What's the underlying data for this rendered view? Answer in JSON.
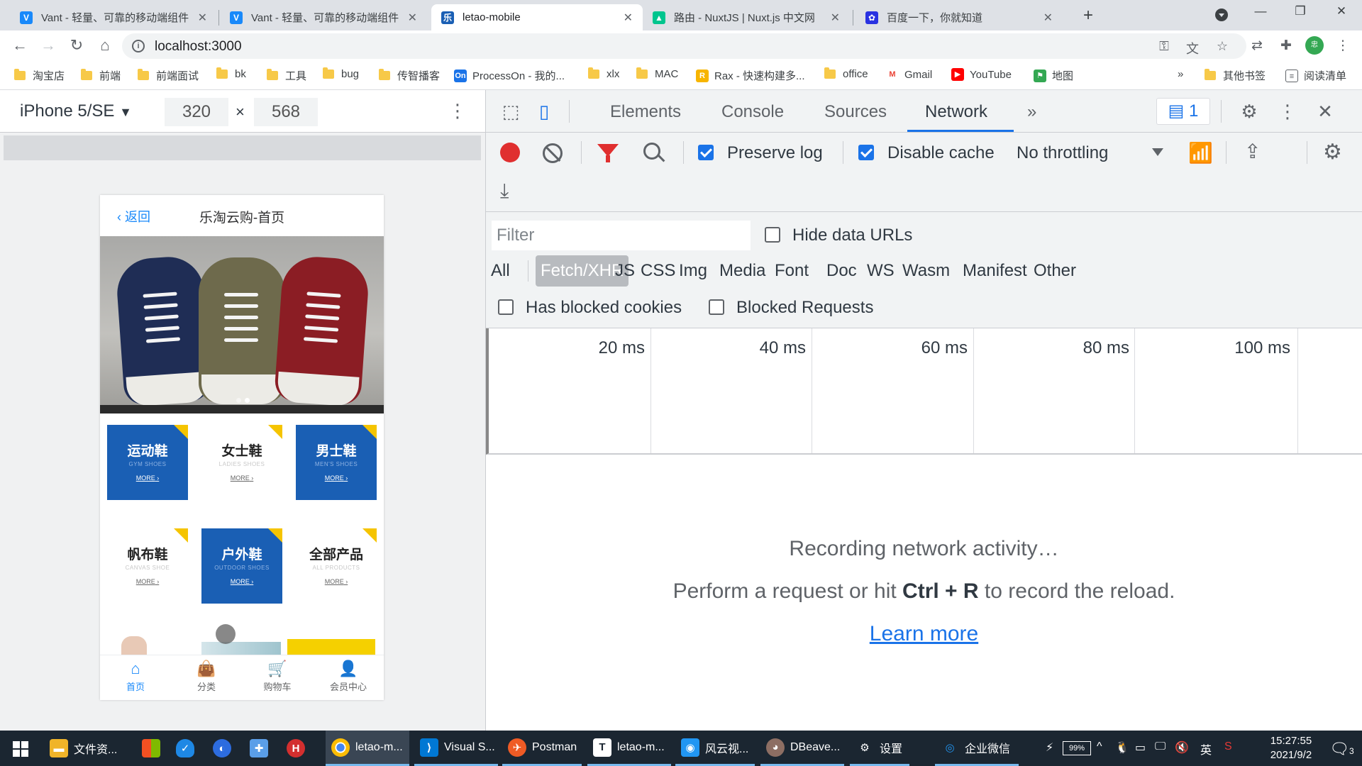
{
  "browser": {
    "tabs": [
      {
        "title": "Vant - 轻量、可靠的移动端组件",
        "icon": "vant-icon",
        "color": "#1989fa"
      },
      {
        "title": "Vant - 轻量、可靠的移动端组件",
        "icon": "vant-icon",
        "color": "#1989fa"
      },
      {
        "title": "letao-mobile",
        "icon": "letao-icon",
        "color": "#1a5fb4"
      },
      {
        "title": "路由 - NuxtJS | Nuxt.js 中文网",
        "icon": "nuxt-icon",
        "color": "#00c58e"
      },
      {
        "title": "百度一下，你就知道",
        "icon": "baidu-icon",
        "color": "#2932e1"
      }
    ],
    "active_tab": 2,
    "new_tab": "+",
    "url": "localhost:3000",
    "bookmarks": [
      {
        "label": "淘宝店",
        "type": "folder"
      },
      {
        "label": "前端",
        "type": "folder"
      },
      {
        "label": "前端面试",
        "type": "folder"
      },
      {
        "label": "bk",
        "type": "folder"
      },
      {
        "label": "工具",
        "type": "folder"
      },
      {
        "label": "bug",
        "type": "folder"
      },
      {
        "label": "传智播客",
        "type": "folder"
      },
      {
        "label": "ProcessOn - 我的...",
        "type": "site",
        "icon": "processon-icon"
      },
      {
        "label": "xlx",
        "type": "folder"
      },
      {
        "label": "MAC",
        "type": "folder"
      },
      {
        "label": "Rax - 快速构建多...",
        "type": "site",
        "icon": "rax-icon"
      },
      {
        "label": "office",
        "type": "folder"
      },
      {
        "label": "Gmail",
        "type": "site",
        "icon": "gmail-icon"
      },
      {
        "label": "YouTube",
        "type": "site",
        "icon": "youtube-icon"
      },
      {
        "label": "地图",
        "type": "site",
        "icon": "maps-icon"
      },
      {
        "label": "»",
        "type": "overflow"
      },
      {
        "label": "其他书签",
        "type": "folder"
      },
      {
        "label": "阅读清单",
        "type": "reading-list"
      }
    ]
  },
  "device_toolbar": {
    "device": "iPhone 5/SE",
    "width": "320",
    "height": "568",
    "times": "×"
  },
  "phone": {
    "back_label": "返回",
    "title": "乐淘云购-首页",
    "categories": [
      {
        "name": "运动鞋",
        "en": "GYM SHOES",
        "more": "MORE",
        "style": "blue"
      },
      {
        "name": "女士鞋",
        "en": "LADIES SHOES",
        "more": "MORE",
        "style": "white"
      },
      {
        "name": "男士鞋",
        "en": "MEN'S SHOES",
        "more": "MORE",
        "style": "blue"
      },
      {
        "name": "帆布鞋",
        "en": "CANVAS SHOE",
        "more": "MORE",
        "style": "white"
      },
      {
        "name": "户外鞋",
        "en": "OUTDOOR SHOES",
        "more": "MORE",
        "style": "blue"
      },
      {
        "name": "全部产品",
        "en": "ALL PRODUCTS",
        "more": "MORE",
        "style": "white"
      }
    ],
    "tabbar": [
      {
        "label": "首页",
        "icon": "home-icon"
      },
      {
        "label": "分类",
        "icon": "category-bag-icon"
      },
      {
        "label": "购物车",
        "icon": "cart-icon"
      },
      {
        "label": "会员中心",
        "icon": "user-icon"
      }
    ]
  },
  "devtools": {
    "tabs": [
      "Elements",
      "Console",
      "Sources",
      "Network"
    ],
    "active_tab": "Network",
    "more_tabs": "»",
    "issues_count": "1",
    "preserve_log": {
      "label": "Preserve log",
      "checked": true
    },
    "disable_cache": {
      "label": "Disable cache",
      "checked": true
    },
    "throttling": "No throttling",
    "filter_placeholder": "Filter",
    "hide_data_urls": {
      "label": "Hide data URLs",
      "checked": false
    },
    "types": [
      "All",
      "Fetch/XHR",
      "JS",
      "CSS",
      "Img",
      "Media",
      "Font",
      "Doc",
      "WS",
      "Wasm",
      "Manifest",
      "Other"
    ],
    "active_type": "Fetch/XHR",
    "has_blocked_cookies": {
      "label": "Has blocked cookies",
      "checked": false
    },
    "blocked_requests": {
      "label": "Blocked Requests",
      "checked": false
    },
    "timeline_ticks": [
      "20 ms",
      "40 ms",
      "60 ms",
      "80 ms",
      "100 ms"
    ],
    "recording_msg": "Recording network activity…",
    "perform_prefix": "Perform a request or hit ",
    "shortcut": "Ctrl + R",
    "perform_suffix": " to record the reload.",
    "learn_more": "Learn more"
  },
  "taskbar": {
    "items": [
      {
        "label": "文件资...",
        "icon": "file-explorer-icon",
        "color": "#f0b429"
      },
      {
        "label": "",
        "icon": "windows-store-icon",
        "color": "#f25022"
      },
      {
        "label": "",
        "icon": "security-shield-icon",
        "color": "#1e88e5"
      },
      {
        "label": "",
        "icon": "browser-globe-icon",
        "color": "#2d6cdf"
      },
      {
        "label": "",
        "icon": "puzzle-app-icon",
        "color": "#5a9ee8"
      },
      {
        "label": "",
        "icon": "hbuilder-icon",
        "color": "#d32f2f"
      },
      {
        "label": "letao-m...",
        "icon": "chrome-icon",
        "color": "#fbbc05"
      },
      {
        "label": "Visual S...",
        "icon": "vscode-icon",
        "color": "#0078d4"
      },
      {
        "label": "Postman",
        "icon": "postman-icon",
        "color": "#ef5b25"
      },
      {
        "label": "letao-m...",
        "icon": "typora-icon",
        "color": "#ffffff"
      },
      {
        "label": "风云视...",
        "icon": "video-app-icon",
        "color": "#2196f3"
      },
      {
        "label": "DBeave...",
        "icon": "dbeaver-icon",
        "color": "#8d6e63"
      },
      {
        "label": "设置",
        "icon": "settings-gear-icon",
        "color": "#1b2631"
      },
      {
        "label": "企业微信",
        "icon": "wecom-icon",
        "color": "#1b2631"
      }
    ],
    "battery": "99%",
    "ime": "英",
    "time": "15:27:55",
    "date": "2021/9/2",
    "notifications": "3"
  }
}
